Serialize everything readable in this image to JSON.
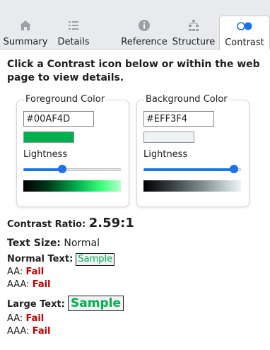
{
  "tabs": [
    {
      "label": "Summary",
      "icon": "home-icon",
      "active": false
    },
    {
      "label": "Details",
      "icon": "list-icon",
      "active": false
    },
    {
      "label": "Reference",
      "icon": "info-icon",
      "active": false
    },
    {
      "label": "Structure",
      "icon": "hierarchy-icon",
      "active": false
    },
    {
      "label": "Contrast",
      "icon": "contrast-icon",
      "active": true
    }
  ],
  "intro": "Click a Contrast icon below or within the web page to view details.",
  "foreground": {
    "legend": "Foreground Color",
    "hex": "#00AF4D",
    "swatch_color": "#00AF4D",
    "lightness_label": "Lightness",
    "lightness_level": 0.4
  },
  "background": {
    "legend": "Background Color",
    "hex": "#EFF3F4",
    "swatch_color": "#EFF3F4",
    "lightness_label": "Lightness",
    "lightness_level": 0.93
  },
  "results": {
    "ratio_label": "Contrast Ratio:",
    "ratio_value": "2.59:1",
    "text_size_label": "Text Size:",
    "text_size_value": "Normal",
    "normal_label": "Normal Text:",
    "normal_sample": "Sample",
    "normal_aa_label": "AA:",
    "normal_aa_value": "Fail",
    "normal_aaa_label": "AAA:",
    "normal_aaa_value": "Fail",
    "large_label": "Large Text:",
    "large_sample": "Sample",
    "large_aa_label": "AA:",
    "large_aa_value": "Fail",
    "large_aaa_label": "AAA:",
    "large_aaa_value": "Fail"
  },
  "colors": {
    "accent": "#1a73e8",
    "fail": "#c00000",
    "sample_fg": "#00AF4D",
    "sample_bg": "#EFF3F4",
    "inactive_icon": "#9aa0a6",
    "active_icon": "#1a73e8"
  }
}
